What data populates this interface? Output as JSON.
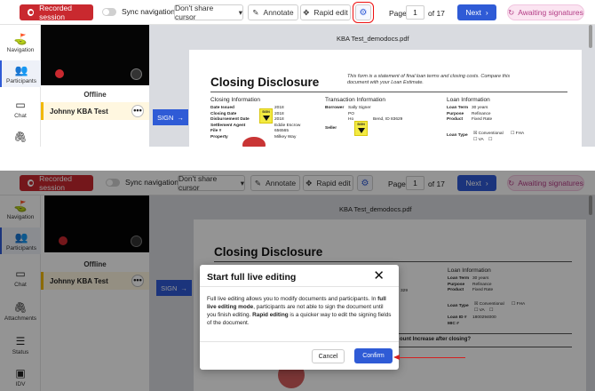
{
  "toolbar": {
    "recorded_session": "Recorded session",
    "sync_navigation": "Sync navigation",
    "share_cursor": "Don't share cursor",
    "annotate": "Annotate",
    "rapid_edit": "Rapid edit",
    "page_label": "Page",
    "page_current": "1",
    "page_total": "of 17",
    "next": "Next",
    "awaiting": "Awaiting signatures"
  },
  "sidebar": {
    "items": [
      {
        "label": "Navigation",
        "icon": "navigation-icon"
      },
      {
        "label": "Participants",
        "icon": "participants-icon"
      },
      {
        "label": "Chat",
        "icon": "chat-icon"
      },
      {
        "label": "Attachments",
        "icon": "attachment-icon"
      },
      {
        "label": "Status",
        "icon": "status-icon"
      },
      {
        "label": "IDV",
        "icon": "idv-icon"
      }
    ]
  },
  "participant": {
    "status": "Offline",
    "name": "Johnny KBA Test",
    "more": "•••"
  },
  "sign_tab": "SIGN",
  "document": {
    "filename": "KBA Test_demodocs.pdf",
    "title": "Closing Disclosure",
    "note": "This form is a statement of final loan terms and closing costs. Compare this document with your Loan Estimate.",
    "closing_info": {
      "heading": "Closing Information",
      "keys": [
        "Date Issued",
        "Closing Date",
        "Disbursement Date",
        "Settlement Agent",
        "File #",
        "Property"
      ],
      "values": [
        "2018",
        "2018",
        "2018",
        "Eddie Escrow",
        "656565",
        "Milkey Way"
      ],
      "values_p2": [
        "",
        "",
        "",
        "",
        "",
        ""
      ]
    },
    "transaction_info": {
      "heading": "Transaction Information",
      "borrower_label": "Borrower",
      "borrower": "Sally Signer",
      "borrower_addr1": "PO",
      "borrower_addr2": "Ho",
      "borrower_city": "Bend, ID 83629",
      "borrower_city_p2": "329",
      "seller_label": "Seller"
    },
    "loan_info": {
      "heading": "Loan Information",
      "term_label": "Loan Term",
      "term": "30 years",
      "purpose_label": "Purpose",
      "purpose": "Refinance",
      "product_label": "Product",
      "product": "Fixed Rate",
      "type_label": "Loan Type",
      "conventional": "☒ Conventional",
      "fha": "☐ FHA",
      "va": "☐ VA",
      "other": "☐",
      "loan_id_label": "Loan ID #",
      "loan_id": "1800294000",
      "mic_label": "MIC #"
    },
    "sign_tag_text": "SIGN",
    "loan_question": "ount Increase after closing?"
  },
  "modal": {
    "title": "Start full live editing",
    "close": "✕",
    "body_1": "Full live editing allows you to modify documents and participants. In ",
    "body_bold_1": "full live editing mode",
    "body_2": ", participants are not able to sign the document until you finish editing. ",
    "body_bold_2": "Rapid editing",
    "body_3": " is a quicker way to edit the signing fields of the document.",
    "cancel": "Cancel",
    "confirm": "Confirm"
  },
  "colors": {
    "accent": "#2f5bd6",
    "record": "#c9292f",
    "awaiting_bg": "#fbe4f1",
    "highlight": "#e11111"
  }
}
